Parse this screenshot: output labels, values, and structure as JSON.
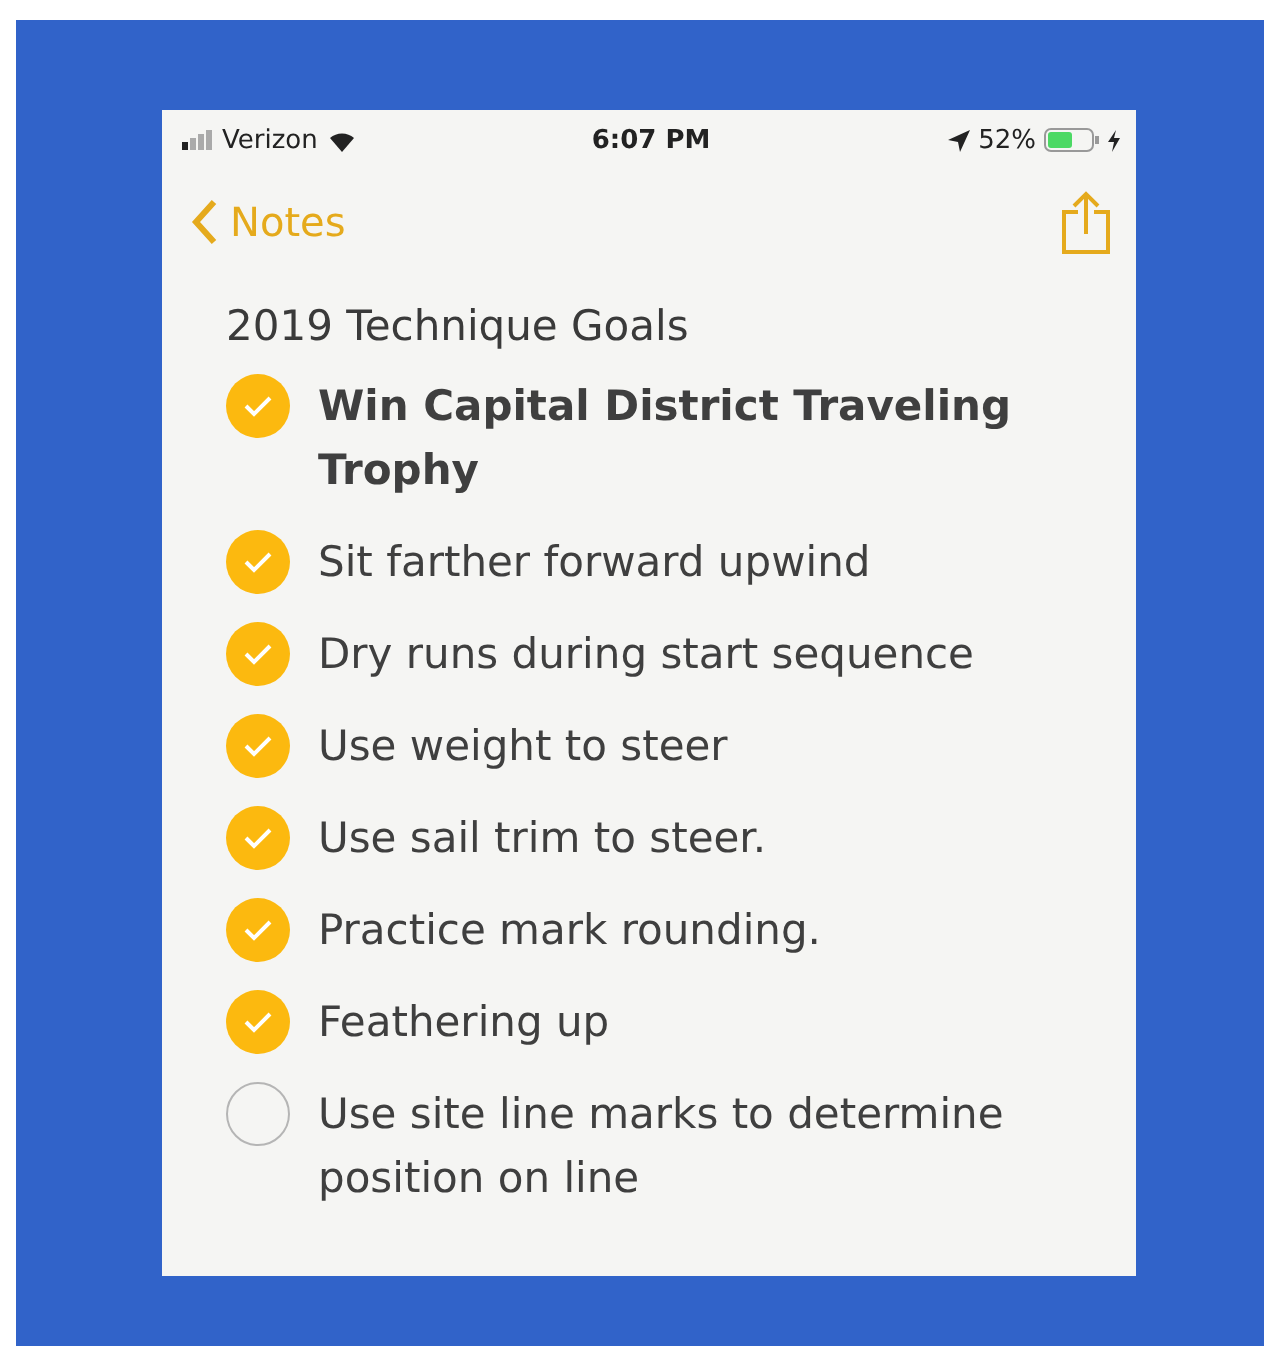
{
  "status_bar": {
    "carrier": "Verizon",
    "time": "6:07 PM",
    "battery": "52%",
    "charging": true
  },
  "nav": {
    "back_label": "Notes"
  },
  "note": {
    "title": "2019 Technique Goals",
    "items": [
      {
        "text": "Win Capital District Traveling Trophy",
        "checked": true,
        "bold": true
      },
      {
        "text": "Sit farther forward upwind",
        "checked": true,
        "bold": false
      },
      {
        "text": "Dry runs during start sequence",
        "checked": true,
        "bold": false
      },
      {
        "text": "Use weight to steer",
        "checked": true,
        "bold": false
      },
      {
        "text": "Use sail trim to steer.",
        "checked": true,
        "bold": false
      },
      {
        "text": "Practice mark rounding.",
        "checked": true,
        "bold": false
      },
      {
        "text": "Feathering up",
        "checked": true,
        "bold": false
      },
      {
        "text": "Use site line marks to determine position on line",
        "checked": false,
        "bold": false
      }
    ]
  }
}
